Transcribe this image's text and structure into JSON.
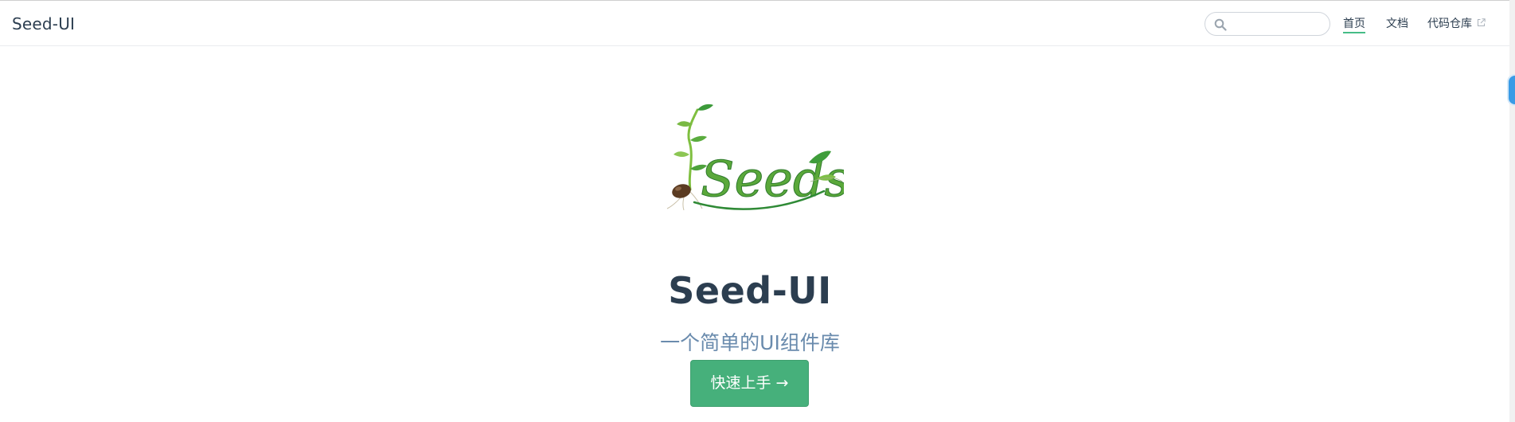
{
  "navbar": {
    "site_name": "Seed-UI",
    "search": {
      "placeholder": "",
      "value": ""
    },
    "links": [
      {
        "label": "首页",
        "active": true
      },
      {
        "label": "文档",
        "active": false
      },
      {
        "label": "代码仓库",
        "active": false,
        "external": true
      }
    ]
  },
  "hero": {
    "logo_text": "Seeds",
    "title": "Seed-UI",
    "description": "一个简单的UI组件库",
    "action_label": "快速上手 →"
  },
  "colors": {
    "accent": "#46b07b",
    "title": "#2c3e50",
    "description": "#6a8bad"
  },
  "icons": [
    "search-icon",
    "external-link-icon",
    "seed-logo"
  ]
}
